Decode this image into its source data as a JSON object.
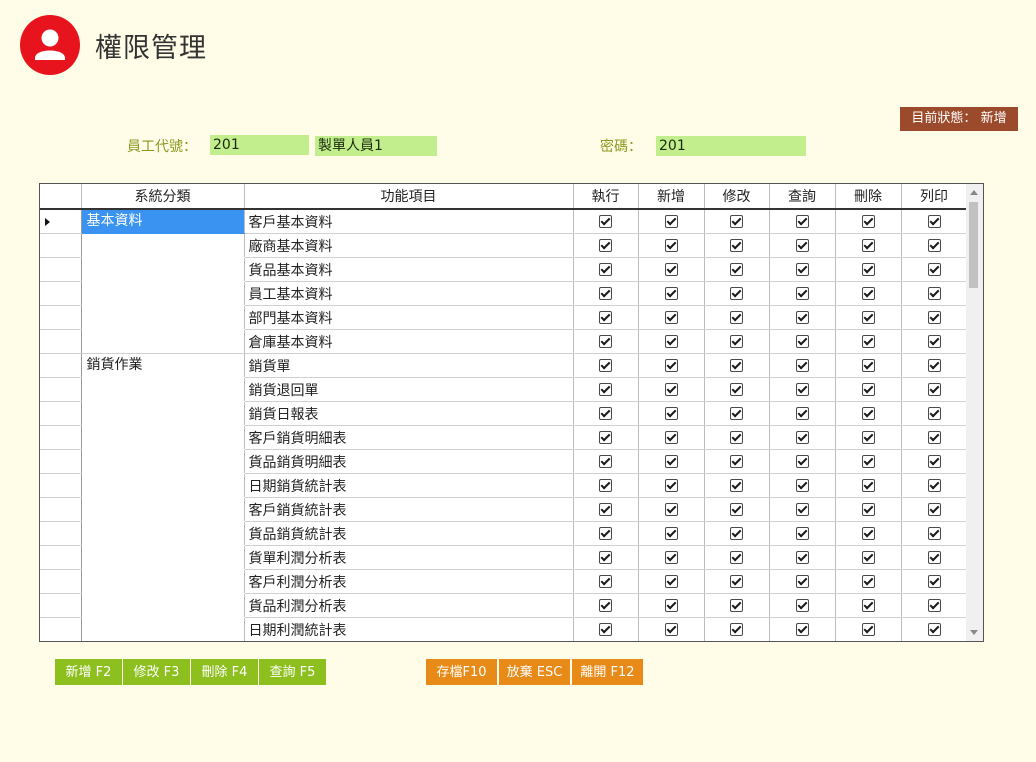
{
  "header": {
    "title": "權限管理",
    "status_label": "目前狀態：",
    "status_value": "新增"
  },
  "form": {
    "emp_code_label": "員工代號：",
    "emp_code": "201",
    "emp_name": "製單人員1",
    "password_label": "密碼：",
    "password": "201"
  },
  "grid": {
    "columns": [
      "系統分類",
      "功能項目",
      "執行",
      "新增",
      "修改",
      "查詢",
      "刪除",
      "列印"
    ],
    "rows": [
      {
        "category": "基本資料",
        "func": "客戶基本資料",
        "checks": [
          true,
          true,
          true,
          true,
          true,
          true
        ]
      },
      {
        "category": "",
        "func": "廠商基本資料",
        "checks": [
          true,
          true,
          true,
          true,
          true,
          true
        ]
      },
      {
        "category": "",
        "func": "貨品基本資料",
        "checks": [
          true,
          true,
          true,
          true,
          true,
          true
        ]
      },
      {
        "category": "",
        "func": "員工基本資料",
        "checks": [
          true,
          true,
          true,
          true,
          true,
          true
        ]
      },
      {
        "category": "",
        "func": "部門基本資料",
        "checks": [
          true,
          true,
          true,
          true,
          true,
          true
        ]
      },
      {
        "category": "",
        "func": "倉庫基本資料",
        "checks": [
          true,
          true,
          true,
          true,
          true,
          true
        ]
      },
      {
        "category": "銷貨作業",
        "func": "銷貨單",
        "checks": [
          true,
          true,
          true,
          true,
          true,
          true
        ]
      },
      {
        "category": "",
        "func": "銷貨退回單",
        "checks": [
          true,
          true,
          true,
          true,
          true,
          true
        ]
      },
      {
        "category": "",
        "func": "銷貨日報表",
        "checks": [
          true,
          true,
          true,
          true,
          true,
          true
        ]
      },
      {
        "category": "",
        "func": "客戶銷貨明細表",
        "checks": [
          true,
          true,
          true,
          true,
          true,
          true
        ]
      },
      {
        "category": "",
        "func": "貨品銷貨明細表",
        "checks": [
          true,
          true,
          true,
          true,
          true,
          true
        ]
      },
      {
        "category": "",
        "func": "日期銷貨統計表",
        "checks": [
          true,
          true,
          true,
          true,
          true,
          true
        ]
      },
      {
        "category": "",
        "func": "客戶銷貨統計表",
        "checks": [
          true,
          true,
          true,
          true,
          true,
          true
        ]
      },
      {
        "category": "",
        "func": "貨品銷貨統計表",
        "checks": [
          true,
          true,
          true,
          true,
          true,
          true
        ]
      },
      {
        "category": "",
        "func": "貨單利潤分析表",
        "checks": [
          true,
          true,
          true,
          true,
          true,
          true
        ]
      },
      {
        "category": "",
        "func": "客戶利潤分析表",
        "checks": [
          true,
          true,
          true,
          true,
          true,
          true
        ]
      },
      {
        "category": "",
        "func": "貨品利潤分析表",
        "checks": [
          true,
          true,
          true,
          true,
          true,
          true
        ]
      },
      {
        "category": "",
        "func": "日期利潤統計表",
        "checks": [
          true,
          true,
          true,
          true,
          true,
          true
        ]
      }
    ]
  },
  "buttons": {
    "add": "新增 F2",
    "edit": "修改 F3",
    "delete": "刪除 F4",
    "query": "查詢 F5",
    "save": "存檔F10",
    "cancel": "放棄 ESC",
    "exit": "離開 F12"
  }
}
